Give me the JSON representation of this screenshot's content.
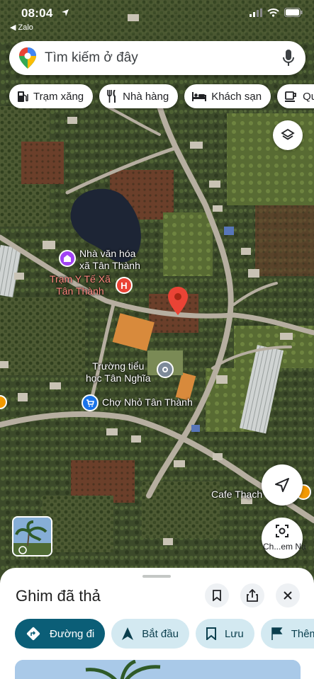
{
  "status_bar": {
    "time": "08:04",
    "back_app": "◀ Zalo"
  },
  "search": {
    "placeholder": "Tìm kiếm ở đây"
  },
  "chips": [
    {
      "label": "Trạm xăng",
      "icon": "gas-station-icon"
    },
    {
      "label": "Nhà hàng",
      "icon": "restaurant-icon"
    },
    {
      "label": "Khách sạn",
      "icon": "hotel-icon"
    },
    {
      "label": "Quán",
      "icon": "cafe-icon"
    }
  ],
  "map_labels": {
    "culture_house": "Nhà văn hóa\nxã Tân Thành",
    "health_station": "Trạm Y Tế Xã\nTân Thành",
    "school": "Trường tiểu\nhọc Tân Nghĩa",
    "market": "Chợ Nhỏ Tân Thành",
    "cafe": "Cafe Thạch"
  },
  "lens_button": {
    "label": "Ch...em Nạ"
  },
  "sheet": {
    "title": "Ghim đã thả",
    "actions": [
      {
        "label": "Đường đi",
        "icon": "directions-icon"
      },
      {
        "label": "Bắt đầu",
        "icon": "navigation-arrow-icon"
      },
      {
        "label": "Lưu",
        "icon": "bookmark-icon"
      },
      {
        "label": "Thêm nhãn",
        "icon": "flag-icon"
      }
    ]
  },
  "colors": {
    "accent": "#0b5e77",
    "pin_red": "#ea4335",
    "poi_purple": "#a142f4",
    "poi_blue": "#1a73e8"
  }
}
